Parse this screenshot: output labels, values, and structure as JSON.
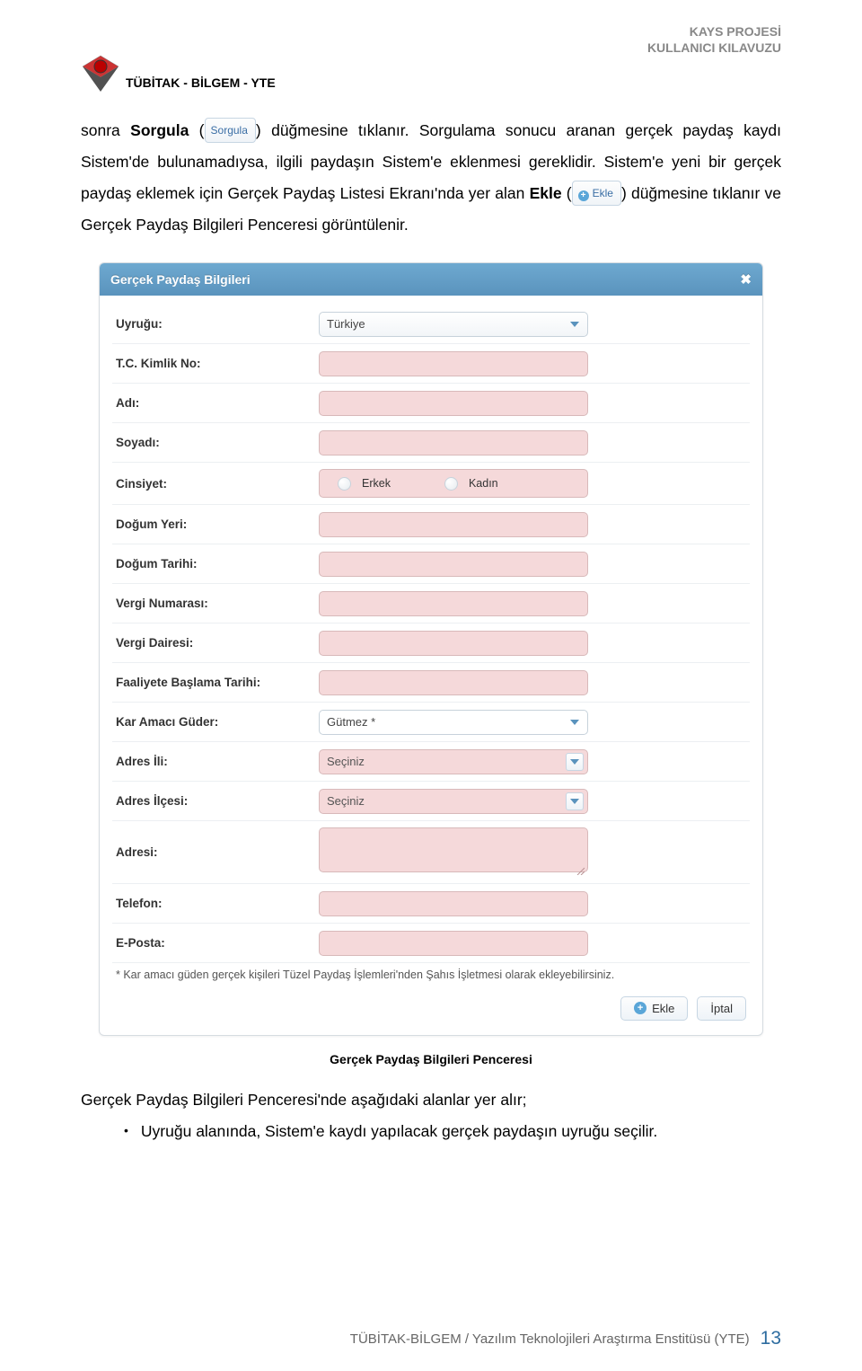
{
  "header": {
    "org": "TÜBİTAK - BİLGEM - YTE",
    "r1": "KAYS PROJESİ",
    "r2": "KULLANICI KILAVUZU"
  },
  "inline_buttons": {
    "sorgula": "Sorgula",
    "ekle": "Ekle"
  },
  "para": {
    "p1a": "sonra ",
    "p1b": "Sorgula",
    "p1c": " (",
    "p1d": ") düğmesine tıklanır. Sorgulama sonucu aranan gerçek paydaş kaydı Sistem'de bulunamadıysa, ilgili paydaşın Sistem'e eklenmesi gereklidir. Sistem'e yeni bir gerçek paydaş eklemek için Gerçek Paydaş Listesi Ekranı'nda yer alan ",
    "p1e": "Ekle",
    "p1f": " (",
    "p1g": ") düğmesine tıklanır ve Gerçek Paydaş Bilgileri Penceresi görüntülenir."
  },
  "dialog": {
    "title": "Gerçek Paydaş Bilgileri",
    "fields": {
      "uyrugu": "Uyruğu:",
      "tckimlik": "T.C. Kimlik No:",
      "adi": "Adı:",
      "soyadi": "Soyadı:",
      "cinsiyet": "Cinsiyet:",
      "dogumyeri": "Doğum Yeri:",
      "dogumtarihi": "Doğum Tarihi:",
      "vergino": "Vergi Numarası:",
      "vergidairesi": "Vergi Dairesi:",
      "faaliyet": "Faaliyete Başlama Tarihi:",
      "karamaci": "Kar Amacı Güder:",
      "adresili": "Adres İli:",
      "adresilcesi": "Adres İlçesi:",
      "adresi": "Adresi:",
      "telefon": "Telefon:",
      "eposta": "E-Posta:"
    },
    "values": {
      "uyrugu": "Türkiye",
      "karamaci": "Gütmez *",
      "adresili": "Seçiniz",
      "adresilcesi": "Seçiniz"
    },
    "gender": {
      "male": "Erkek",
      "female": "Kadın"
    },
    "note": "* Kar amacı güden gerçek kişileri Tüzel Paydaş İşlemleri'nden Şahıs İşletmesi olarak ekleyebilirsiniz.",
    "btn_ekle": "Ekle",
    "btn_iptal": "İptal"
  },
  "caption": "Gerçek Paydaş Bilgileri Penceresi",
  "after": {
    "line1": "Gerçek Paydaş Bilgileri Penceresi'nde aşağıdaki alanlar yer alır;",
    "bullet_bold": "Uyruğu",
    "bullet_rest": " alanında, Sistem'e kaydı yapılacak gerçek paydaşın uyruğu seçilir."
  },
  "footer": {
    "text": "TÜBİTAK-BİLGEM / Yazılım Teknolojileri Araştırma Enstitüsü (YTE)",
    "page": "13"
  }
}
